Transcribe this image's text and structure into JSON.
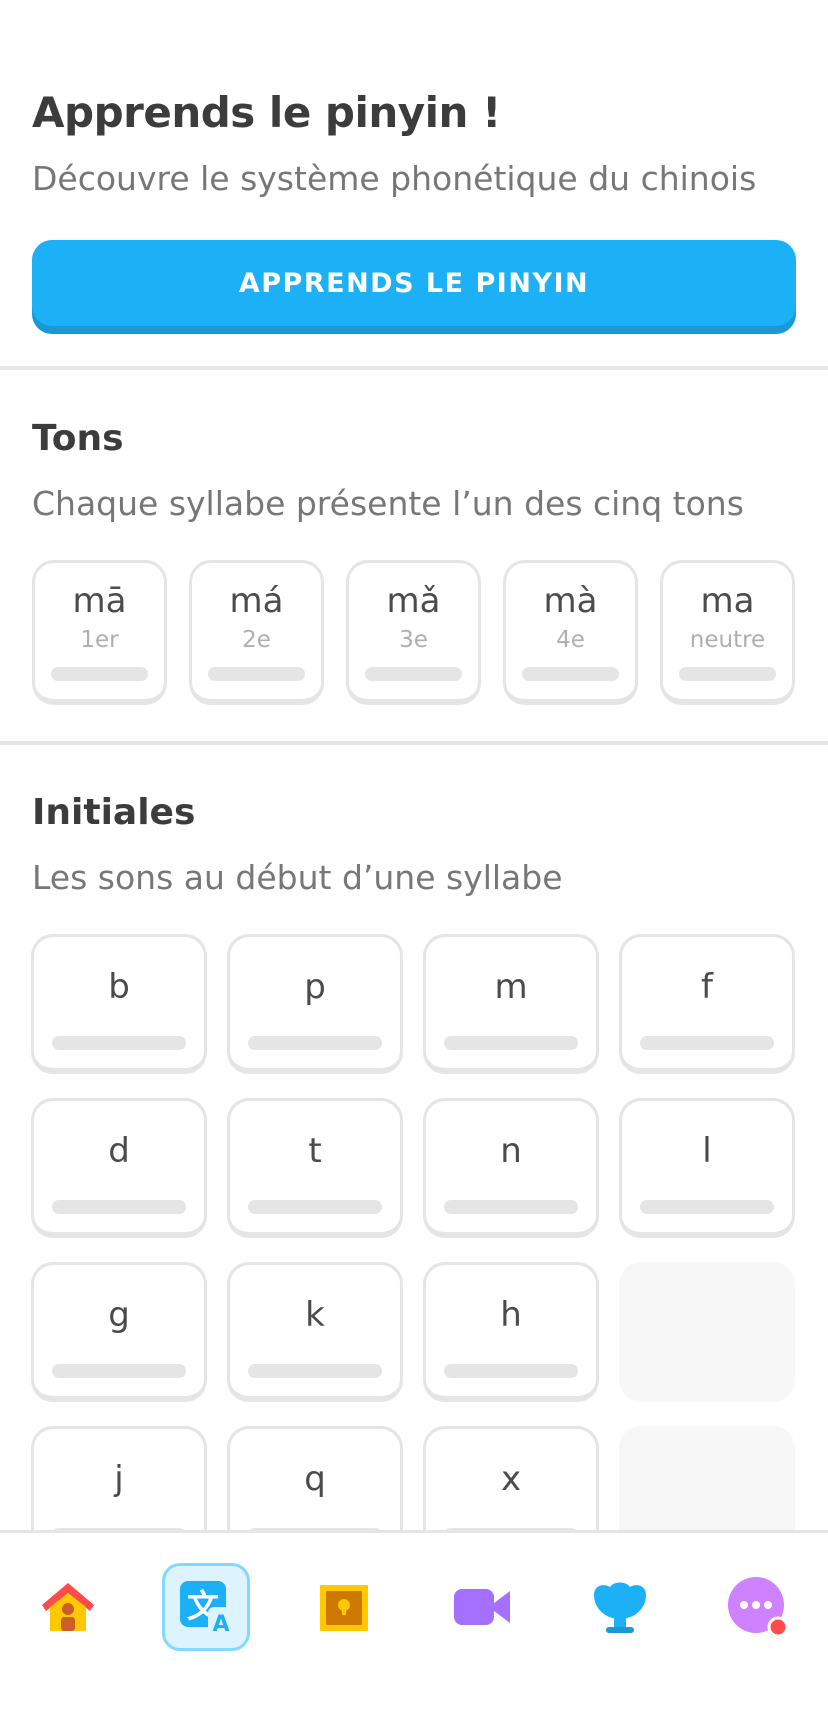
{
  "hero": {
    "title": "Apprends le pinyin !",
    "subtitle": "Découvre le système phonétique du chinois",
    "cta_label": "APPRENDS LE PINYIN"
  },
  "tones": {
    "title": "Tons",
    "subtitle": "Chaque syllabe présente l’un des cinq tons",
    "items": [
      {
        "symbol": "mā",
        "label": "1er"
      },
      {
        "symbol": "má",
        "label": "2e"
      },
      {
        "symbol": "mǎ",
        "label": "3e"
      },
      {
        "symbol": "mà",
        "label": "4e"
      },
      {
        "symbol": "ma",
        "label": "neutre"
      }
    ]
  },
  "initials": {
    "title": "Initiales",
    "subtitle": "Les sons au début d’une syllabe",
    "items": [
      "b",
      "p",
      "m",
      "f",
      "d",
      "t",
      "n",
      "l",
      "g",
      "k",
      "h",
      "",
      "j",
      "q",
      "x",
      ""
    ]
  },
  "nav": {
    "items": [
      {
        "icon": "home-icon",
        "active": false
      },
      {
        "icon": "characters-translate-icon",
        "active": true
      },
      {
        "icon": "treasure-chest-icon",
        "active": false
      },
      {
        "icon": "video-camera-icon",
        "active": false
      },
      {
        "icon": "shell-icon",
        "active": false
      },
      {
        "icon": "more-icon",
        "active": false,
        "badge": true
      }
    ],
    "colors": {
      "active_bg": "#ddf4ff",
      "active_border": "#84d8ff",
      "accent": "#1cb0f6",
      "badge": "#ff4b4b"
    }
  }
}
